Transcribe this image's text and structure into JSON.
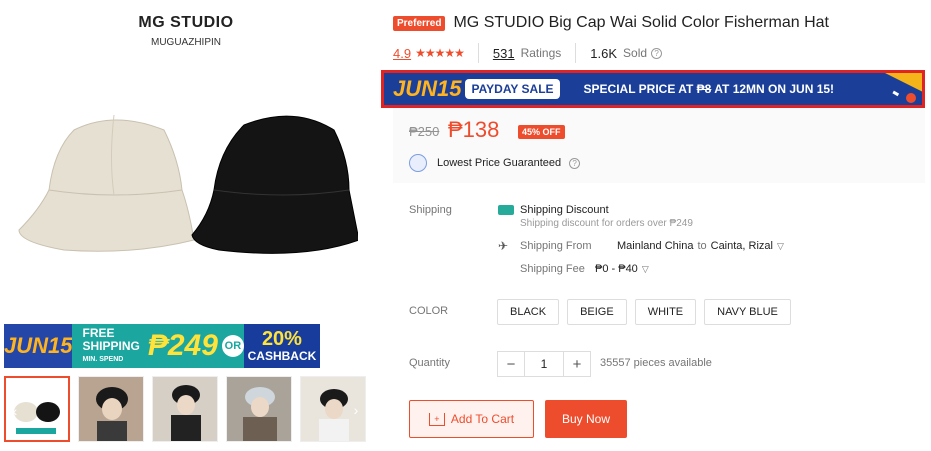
{
  "gallery": {
    "brand": "MG STUDIO",
    "brand_sub": "MUGUAZHIPIN",
    "promo": {
      "jun": "JUN15",
      "free": "FREE",
      "shipping": "SHIPPING",
      "min_spend": "MIN. SPEND",
      "amount": "₱249",
      "or": "OR",
      "pct": "20%",
      "cashback": "CASHBACK"
    }
  },
  "product": {
    "badge": "Preferred",
    "title": "MG STUDIO Big Cap Wai Solid Color Fisherman Hat",
    "rating": "4.9",
    "stars": "★★★★★",
    "ratings_count": "531",
    "ratings_label": "Ratings",
    "sold_count": "1.6K",
    "sold_label": "Sold"
  },
  "payday": {
    "jun": "JUN15",
    "pill": "PAYDAY SALE",
    "text_prefix": "SPECIAL PRICE AT ",
    "text_price": "₱8",
    "text_suffix": " AT 12MN ON JUN 15!"
  },
  "price": {
    "old": "₱250",
    "new": "₱138",
    "discount": "45% OFF",
    "guarantee": "Lowest Price Guaranteed"
  },
  "shipping": {
    "label": "Shipping",
    "discount_title": "Shipping Discount",
    "discount_sub": "Shipping discount for orders over ₱249",
    "from_label": "Shipping From",
    "from_value": "Mainland China",
    "to_word": "to",
    "to_value": "Cainta, Rizal",
    "fee_label": "Shipping Fee",
    "fee_value": "₱0 - ₱40"
  },
  "color": {
    "label": "COLOR",
    "options": [
      "BLACK",
      "BEIGE",
      "WHITE",
      "NAVY BLUE"
    ]
  },
  "quantity": {
    "label": "Quantity",
    "value": "1",
    "minus": "−",
    "plus": "+",
    "available": "35557 pieces available"
  },
  "actions": {
    "add_to_cart": "Add To Cart",
    "buy_now": "Buy Now"
  },
  "colors": {
    "accent": "#ee4d2d",
    "banner_blue": "#1b3f98",
    "highlight_red": "#e02424",
    "teal": "#1ba6a0"
  }
}
